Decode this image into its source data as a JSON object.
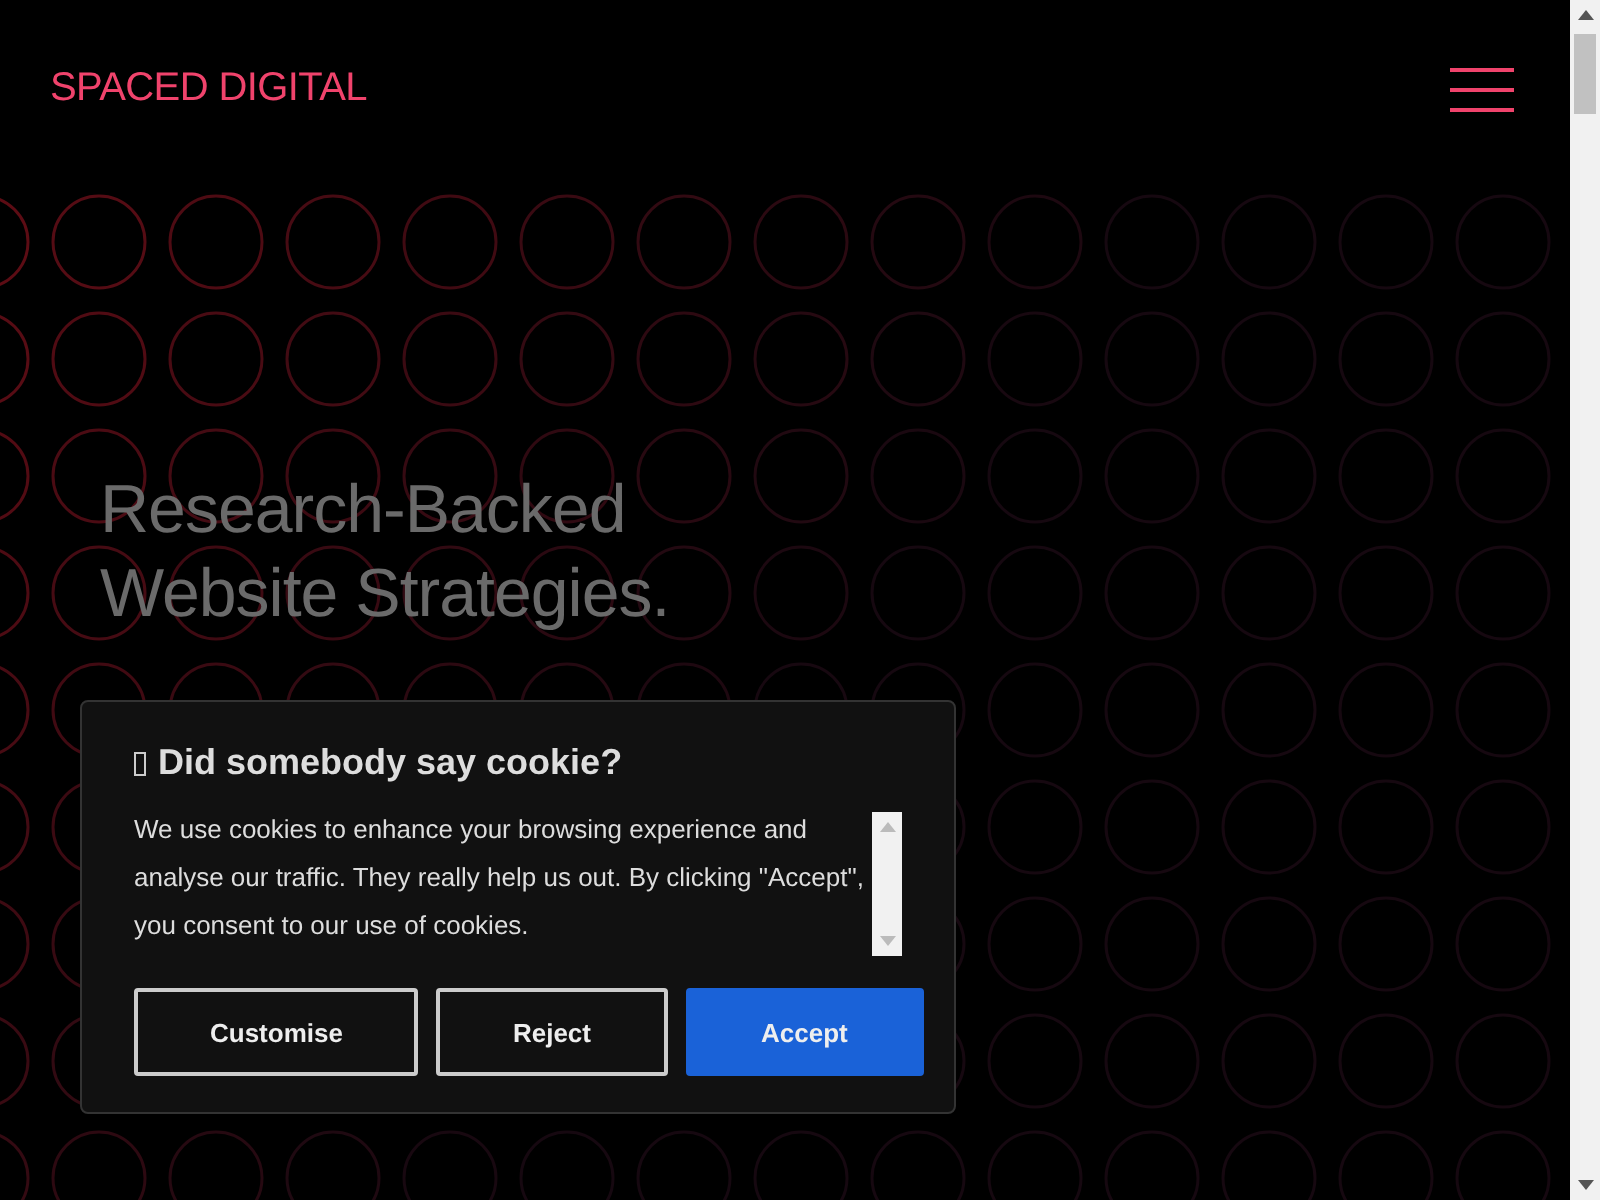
{
  "header": {
    "logo": "SPACED DIGITAL"
  },
  "hero": {
    "headline_lines": [
      "Research-Backed",
      "Website Strategies."
    ]
  },
  "cookie_banner": {
    "title": "Did somebody say cookie?",
    "body": "We use cookies to enhance your browsing experience and analyse our traffic. They really help us out. By clicking \"Accept\", you consent to our use of cookies.",
    "buttons": [
      {
        "label": "Customise",
        "kind": "outline"
      },
      {
        "label": "Reject",
        "kind": "outline"
      },
      {
        "label": "Accept",
        "kind": "primary"
      }
    ]
  }
}
